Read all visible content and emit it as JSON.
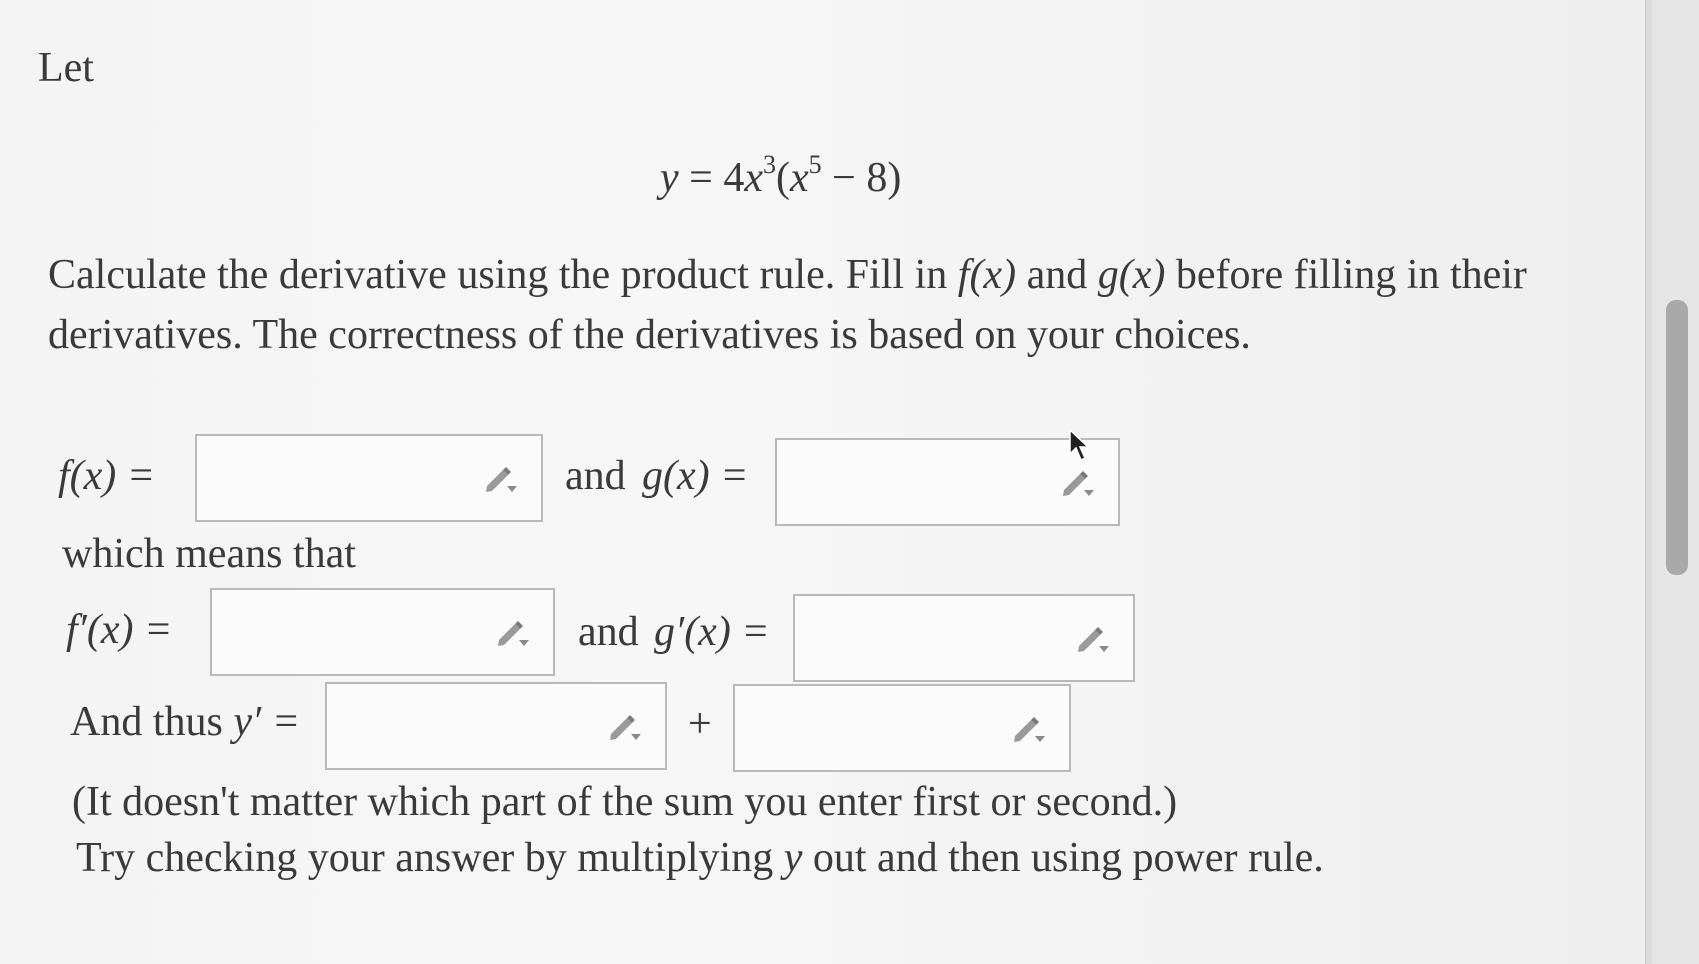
{
  "intro": "Let",
  "equation": {
    "lhs": "y",
    "eq": "=",
    "coef": "4",
    "var1": "x",
    "exp1": "3",
    "open": "(",
    "var2": "x",
    "exp2": "5",
    "minus": "−",
    "const": "8",
    "close": ")"
  },
  "instructions": {
    "part1": "Calculate the derivative using the product rule. Fill in ",
    "fx": "f(x)",
    "part2": " and ",
    "gx": "g(x)",
    "part3": " before filling in their derivatives. The correctness of the derivatives is based on your choices."
  },
  "row1": {
    "f_label": "f(x) =",
    "and_label": "and",
    "g_label": "g(x) ="
  },
  "which_means": "which means that",
  "row2": {
    "fp_label": "f′(x) =",
    "and_label": "and",
    "gp_label": "g′(x) ="
  },
  "row3": {
    "label": "And thus",
    "yp_label": "y′ =",
    "plus": "+"
  },
  "note1": "(It doesn't matter which part of the sum you enter first or second.)",
  "note2_a": "Try checking your answer by multiplying ",
  "note2_y": "y",
  "note2_b": " out and then using power rule.",
  "inputs": {
    "f": "",
    "g": "",
    "f_prime": "",
    "g_prime": "",
    "y_prime_1": "",
    "y_prime_2": ""
  },
  "icons": {
    "edit": "pencil-dropdown-icon",
    "cursor": "mouse-pointer-icon"
  }
}
